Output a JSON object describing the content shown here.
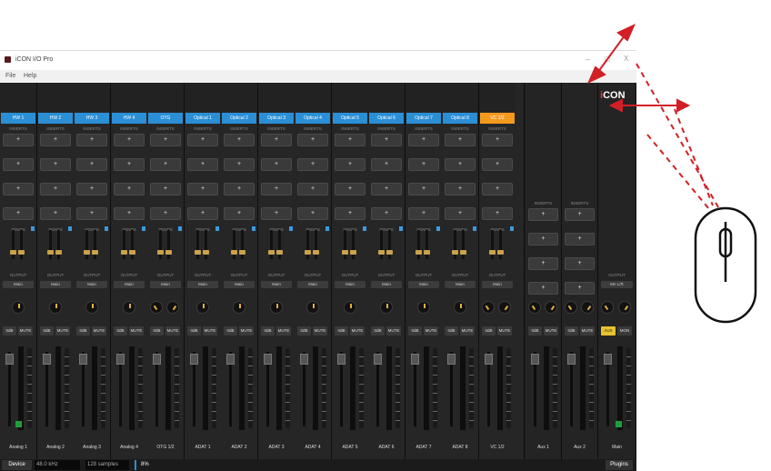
{
  "window": {
    "title": "iCON I/O Pro",
    "minimize": "–",
    "maximize": "□",
    "close": "X"
  },
  "menu": [
    "File",
    "Help"
  ],
  "channels": [
    {
      "name": "HW 1",
      "footer": "Analog 1"
    },
    {
      "name": "HW 2",
      "footer": "Analog 2"
    },
    {
      "name": "HW 3",
      "footer": "Analog 3"
    },
    {
      "name": "HW 4",
      "footer": "Analog 4"
    },
    {
      "name": "OTG",
      "footer": "OTG 1/2"
    },
    {
      "name": "Optical 1",
      "footer": "ADAT 1"
    },
    {
      "name": "Optical 2",
      "footer": "ADAT 2"
    },
    {
      "name": "Optical 3",
      "footer": "ADAT 3"
    },
    {
      "name": "Optical 4",
      "footer": "ADAT 4"
    },
    {
      "name": "Optical 5",
      "footer": "ADAT 5"
    },
    {
      "name": "Optical 6",
      "footer": "ADAT 6"
    },
    {
      "name": "Optical 7",
      "footer": "ADAT 7"
    },
    {
      "name": "Optical 8",
      "footer": "ADAT 8"
    },
    {
      "name": "VC 1/2",
      "footer": "VC 1/2",
      "highlight": true
    }
  ],
  "labels": {
    "inserts": "INSERTS",
    "sends": "SENDS",
    "output": "OUTPUT",
    "main": "Main",
    "main_lr": "Mn L/R",
    "odb": "0dB",
    "mute": "MUTE",
    "aux": "AUX",
    "mon": "MON",
    "plus": "+"
  },
  "aux_channels": [
    {
      "footer": "Aux 1"
    },
    {
      "footer": "Aux 2"
    }
  ],
  "main_channel": {
    "footer": "Main"
  },
  "logo": {
    "i": "i",
    "rest": "CON"
  },
  "bottom": {
    "device": "Device",
    "sample_rate": "48.0 kHz",
    "buffer": "128 samples",
    "cpu": "8%",
    "plugins": "Plugins"
  },
  "colors": {
    "accent": "#2b8fd6",
    "highlight": "#f39a1e",
    "arrow": "#d21f26"
  }
}
